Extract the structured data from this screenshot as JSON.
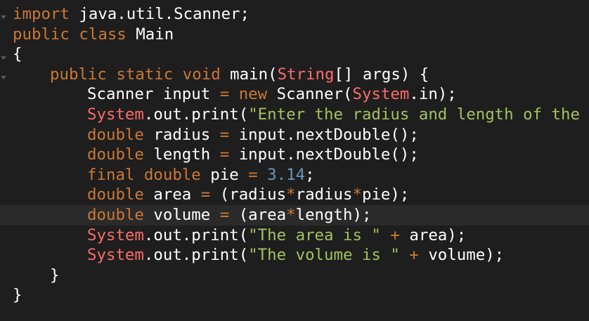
{
  "editor": {
    "lines": [
      {
        "tokens": [
          {
            "t": "import",
            "c": "kw"
          },
          {
            "t": " java.util.Scanner;",
            "c": "id"
          }
        ]
      },
      {
        "tokens": [
          {
            "t": "public",
            "c": "kw"
          },
          {
            "t": " ",
            "c": "id"
          },
          {
            "t": "class",
            "c": "kw"
          },
          {
            "t": " Main",
            "c": "id"
          }
        ]
      },
      {
        "tokens": [
          {
            "t": "{",
            "c": "id"
          }
        ]
      },
      {
        "indent": 1,
        "tokens": [
          {
            "t": "public",
            "c": "kw"
          },
          {
            "t": " ",
            "c": "id"
          },
          {
            "t": "static",
            "c": "kw"
          },
          {
            "t": " ",
            "c": "id"
          },
          {
            "t": "void",
            "c": "kw"
          },
          {
            "t": " main(",
            "c": "id"
          },
          {
            "t": "String",
            "c": "ty"
          },
          {
            "t": "[] args) {",
            "c": "id"
          }
        ]
      },
      {
        "indent": 2,
        "tokens": [
          {
            "t": "Scanner input ",
            "c": "id"
          },
          {
            "t": "=",
            "c": "op"
          },
          {
            "t": " ",
            "c": "id"
          },
          {
            "t": "new",
            "c": "kw"
          },
          {
            "t": " Scanner(",
            "c": "id"
          },
          {
            "t": "System",
            "c": "ty"
          },
          {
            "t": ".in);",
            "c": "id"
          }
        ]
      },
      {
        "indent": 2,
        "tokens": [
          {
            "t": "System",
            "c": "ty"
          },
          {
            "t": ".out.print(",
            "c": "id"
          },
          {
            "t": "\"Enter the radius and length of the cy",
            "c": "str"
          }
        ]
      },
      {
        "indent": 2,
        "tokens": [
          {
            "t": "double",
            "c": "kw"
          },
          {
            "t": " radius ",
            "c": "id"
          },
          {
            "t": "=",
            "c": "op"
          },
          {
            "t": " input.nextDouble();",
            "c": "id"
          }
        ]
      },
      {
        "indent": 2,
        "tokens": [
          {
            "t": "double",
            "c": "kw"
          },
          {
            "t": " length ",
            "c": "id"
          },
          {
            "t": "=",
            "c": "op"
          },
          {
            "t": " input.nextDouble();",
            "c": "id"
          }
        ]
      },
      {
        "indent": 2,
        "tokens": [
          {
            "t": "final",
            "c": "kw"
          },
          {
            "t": " ",
            "c": "id"
          },
          {
            "t": "double",
            "c": "kw"
          },
          {
            "t": " pie ",
            "c": "id"
          },
          {
            "t": "=",
            "c": "op"
          },
          {
            "t": " ",
            "c": "id"
          },
          {
            "t": "3.14",
            "c": "num"
          },
          {
            "t": ";",
            "c": "id"
          }
        ]
      },
      {
        "indent": 2,
        "tokens": [
          {
            "t": "double",
            "c": "kw"
          },
          {
            "t": " area ",
            "c": "id"
          },
          {
            "t": "=",
            "c": "op"
          },
          {
            "t": " (radius",
            "c": "id"
          },
          {
            "t": "*",
            "c": "op"
          },
          {
            "t": "radius",
            "c": "id"
          },
          {
            "t": "*",
            "c": "op"
          },
          {
            "t": "pie);",
            "c": "id"
          }
        ]
      },
      {
        "indent": 2,
        "current": true,
        "tokens": [
          {
            "t": "double",
            "c": "kw"
          },
          {
            "t": " volume ",
            "c": "id"
          },
          {
            "t": "=",
            "c": "op"
          },
          {
            "t": " (area",
            "c": "id"
          },
          {
            "t": "*",
            "c": "op"
          },
          {
            "t": "length);",
            "c": "id"
          }
        ]
      },
      {
        "indent": 2,
        "tokens": [
          {
            "t": "System",
            "c": "ty"
          },
          {
            "t": ".out.print(",
            "c": "id"
          },
          {
            "t": "\"The area is \"",
            "c": "str"
          },
          {
            "t": " ",
            "c": "id"
          },
          {
            "t": "+",
            "c": "op"
          },
          {
            "t": " area);",
            "c": "id"
          }
        ]
      },
      {
        "indent": 2,
        "tokens": [
          {
            "t": "System",
            "c": "ty"
          },
          {
            "t": ".out.print(",
            "c": "id"
          },
          {
            "t": "\"The volume is \"",
            "c": "str"
          },
          {
            "t": " ",
            "c": "id"
          },
          {
            "t": "+",
            "c": "op"
          },
          {
            "t": " volume);",
            "c": "id"
          }
        ]
      },
      {
        "indent": 1,
        "tokens": [
          {
            "t": "}",
            "c": "id"
          }
        ]
      },
      {
        "tokens": [
          {
            "t": "}",
            "c": "id"
          }
        ]
      }
    ]
  }
}
